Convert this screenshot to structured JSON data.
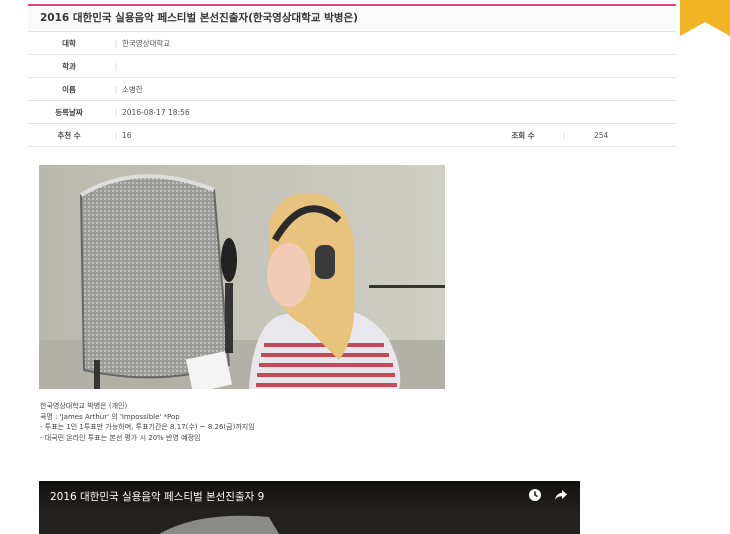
{
  "post": {
    "title": "2016 대한민국 실용음악 페스티벌 본선진출자(한국영상대학교 박병은)",
    "fields": [
      {
        "label": "대학",
        "value": "한국영상대학교"
      },
      {
        "label": "학과",
        "value": ""
      },
      {
        "label": "이름",
        "value": "소병한"
      },
      {
        "label": "등록날짜",
        "value": "2016-08-17 18:56"
      }
    ],
    "recommend_label": "추천 수",
    "recommend_value": "16",
    "views_label": "조회 수",
    "views_value": "254"
  },
  "caption": {
    "lines": [
      "한국영상대학교 박병은 (개인)",
      "곡명 : 'James Arthur' 의 'Impossible' *Pop",
      "- 투표는 1인 1투표만 가능하며, 투표기간은 8.17(수) ~ 8.26(금)까지임",
      "- 대국민 온라인 투표는 본선 평가 시 20% 반영 예정임"
    ]
  },
  "video": {
    "title": "2016 대한민국 실용음악 페스티벌 본선진출자 9",
    "icons": [
      "clock-icon",
      "share-icon"
    ]
  },
  "colors": {
    "accent": "#e0457b",
    "ribbon": "#f2b424"
  }
}
